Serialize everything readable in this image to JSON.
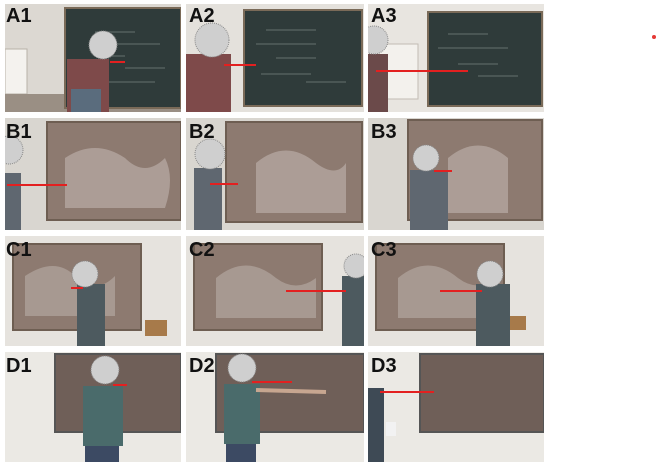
{
  "figure": {
    "panels": [
      {
        "id": "A1",
        "label": "A1"
      },
      {
        "id": "A2",
        "label": "A2"
      },
      {
        "id": "A3",
        "label": "A3"
      },
      {
        "id": "B1",
        "label": "B1"
      },
      {
        "id": "B2",
        "label": "B2"
      },
      {
        "id": "B3",
        "label": "B3"
      },
      {
        "id": "C1",
        "label": "C1"
      },
      {
        "id": "C2",
        "label": "C2"
      },
      {
        "id": "C3",
        "label": "C3"
      },
      {
        "id": "D1",
        "label": "D1"
      },
      {
        "id": "D2",
        "label": "D2"
      },
      {
        "id": "D3",
        "label": "D3"
      }
    ],
    "colors": {
      "gaze_line": "#e32020",
      "chalkboard_dark": "#2f3b3a",
      "chalkboard_brown": "#8d7a70",
      "wall": "#e9e6e1"
    }
  }
}
